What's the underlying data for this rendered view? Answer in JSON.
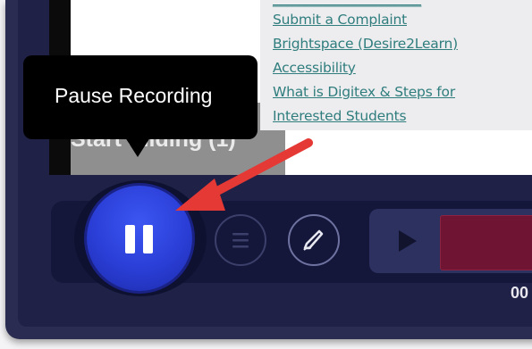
{
  "tooltip": {
    "text": "Pause Recording"
  },
  "overlay_text": "Start Sliding (1)",
  "links": [
    "Submit a Complaint",
    "Brightspace (Desire2Learn)",
    "Accessibility",
    "What is Digitex & Steps for",
    "Interested Students"
  ],
  "controls": {
    "record_button_icon": "pause-icon",
    "menu_icon": "hamburger-menu-icon",
    "pen_icon": "pen-draw-icon",
    "play_icon": "play-icon",
    "timer_partial": "00"
  },
  "colors": {
    "record_button": "#2f45e0",
    "arrow": "#e53935",
    "timeline_block": "#6f1533",
    "link": "#2f7d7d"
  }
}
